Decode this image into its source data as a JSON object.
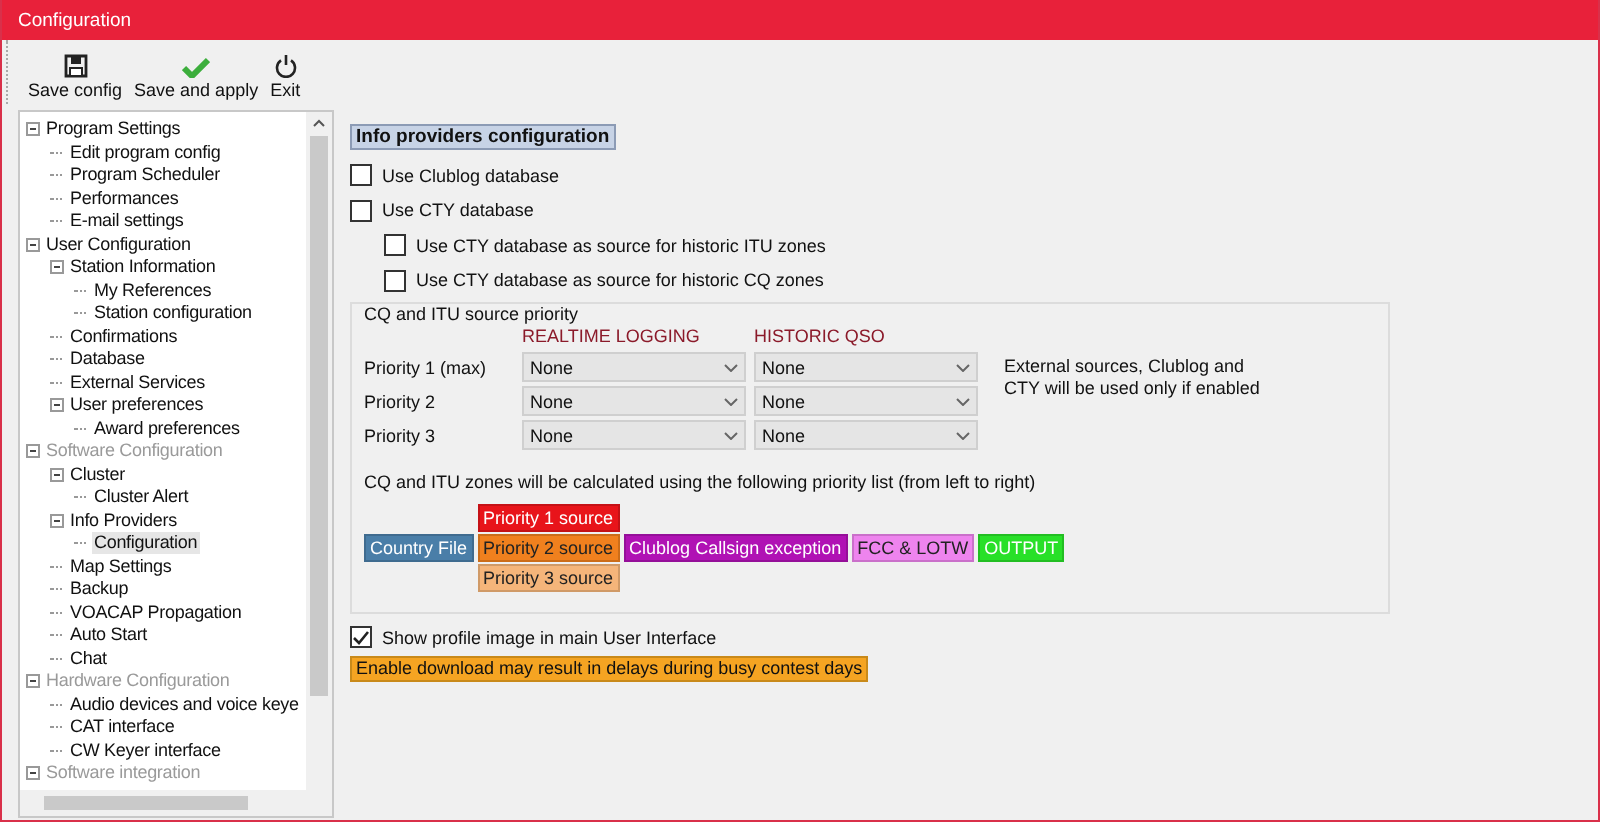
{
  "window": {
    "title": "Configuration"
  },
  "toolbar": [
    {
      "kind": "save",
      "label": "Save config"
    },
    {
      "kind": "apply",
      "label": "Save and apply"
    },
    {
      "kind": "exit",
      "label": "Exit"
    }
  ],
  "tree": [
    {
      "label": "Program Settings",
      "expanded": true,
      "disabled": false,
      "selected": false,
      "children": [
        {
          "label": "Edit program config",
          "selected": false
        },
        {
          "label": "Program Scheduler",
          "selected": false
        },
        {
          "label": "Performances",
          "selected": false
        },
        {
          "label": "E-mail settings",
          "selected": false
        }
      ]
    },
    {
      "label": "User Configuration",
      "expanded": true,
      "disabled": false,
      "selected": false,
      "children": [
        {
          "label": "Station Information",
          "expanded": true,
          "selected": false,
          "children": [
            {
              "label": "My References",
              "selected": false
            },
            {
              "label": "Station configuration",
              "selected": false
            }
          ]
        },
        {
          "label": "Confirmations",
          "selected": false
        },
        {
          "label": "Database",
          "selected": false
        },
        {
          "label": "External Services",
          "selected": false
        },
        {
          "label": "User preferences",
          "expanded": true,
          "selected": false,
          "children": [
            {
              "label": "Award preferences",
              "selected": false
            }
          ]
        }
      ]
    },
    {
      "label": "Software Configuration",
      "expanded": true,
      "disabled": true,
      "selected": false,
      "children": [
        {
          "label": "Cluster",
          "expanded": true,
          "selected": false,
          "children": [
            {
              "label": "Cluster Alert",
              "selected": false
            }
          ]
        },
        {
          "label": "Info Providers",
          "expanded": true,
          "selected": false,
          "children": [
            {
              "label": "Configuration",
              "selected": true
            }
          ]
        },
        {
          "label": "Map Settings",
          "selected": false
        },
        {
          "label": "Backup",
          "selected": false
        },
        {
          "label": "VOACAP Propagation",
          "selected": false
        },
        {
          "label": "Auto Start",
          "selected": false
        },
        {
          "label": "Chat",
          "selected": false
        }
      ]
    },
    {
      "label": "Hardware Configuration",
      "expanded": true,
      "disabled": true,
      "selected": false,
      "children": [
        {
          "label": "Audio devices and voice keye",
          "selected": false
        },
        {
          "label": "CAT interface",
          "selected": false
        },
        {
          "label": "CW Keyer interface",
          "selected": false
        }
      ]
    },
    {
      "label": "Software integration",
      "expanded": true,
      "disabled": true,
      "selected": false
    }
  ],
  "panel": {
    "heading": "Info providers configuration",
    "options": [
      {
        "label": "Use Clublog database",
        "checked": false
      },
      {
        "label": "Use CTY database",
        "checked": false,
        "children": [
          {
            "label": "Use CTY database as source for historic ITU zones",
            "checked": false
          },
          {
            "label": "Use CTY database as source for historic CQ zones",
            "checked": false
          }
        ]
      }
    ],
    "priority_group": {
      "title": "CQ and ITU source priority",
      "columns": [
        "REALTIME LOGGING",
        "HISTORIC QSO"
      ],
      "rows": [
        {
          "label": "Priority 1 (max)",
          "values": [
            "None",
            "None"
          ]
        },
        {
          "label": "Priority 2",
          "values": [
            "None",
            "None"
          ]
        },
        {
          "label": "Priority 3",
          "values": [
            "None",
            "None"
          ]
        }
      ],
      "note": "External sources, Clublog and\nCTY will be used only if enabled",
      "explanation": "CQ and ITU zones will be calculated using the following priority list (from left to right)",
      "chain": [
        {
          "stack": [
            {
              "label": "Country File",
              "color": "#4a7ea8"
            }
          ]
        },
        {
          "stack": [
            {
              "label": "Priority 1 source",
              "color": "#e8141a"
            },
            {
              "label": "Priority 2 source",
              "color": "#f0801e"
            },
            {
              "label": "Priority 3 source",
              "color": "#f5b57a"
            }
          ]
        },
        {
          "stack": [
            {
              "label": "Clublog Callsign exception",
              "color": "#b012b4"
            }
          ]
        },
        {
          "stack": [
            {
              "label": "FCC & LOTW",
              "color": "#ee84ee"
            }
          ]
        },
        {
          "stack": [
            {
              "label": "OUTPUT",
              "color": "#28e028"
            }
          ]
        }
      ]
    },
    "profile_option": {
      "label": "Show profile image in main User Interface",
      "checked": true
    },
    "warning": "Enable download may result in delays during busy contest days"
  }
}
